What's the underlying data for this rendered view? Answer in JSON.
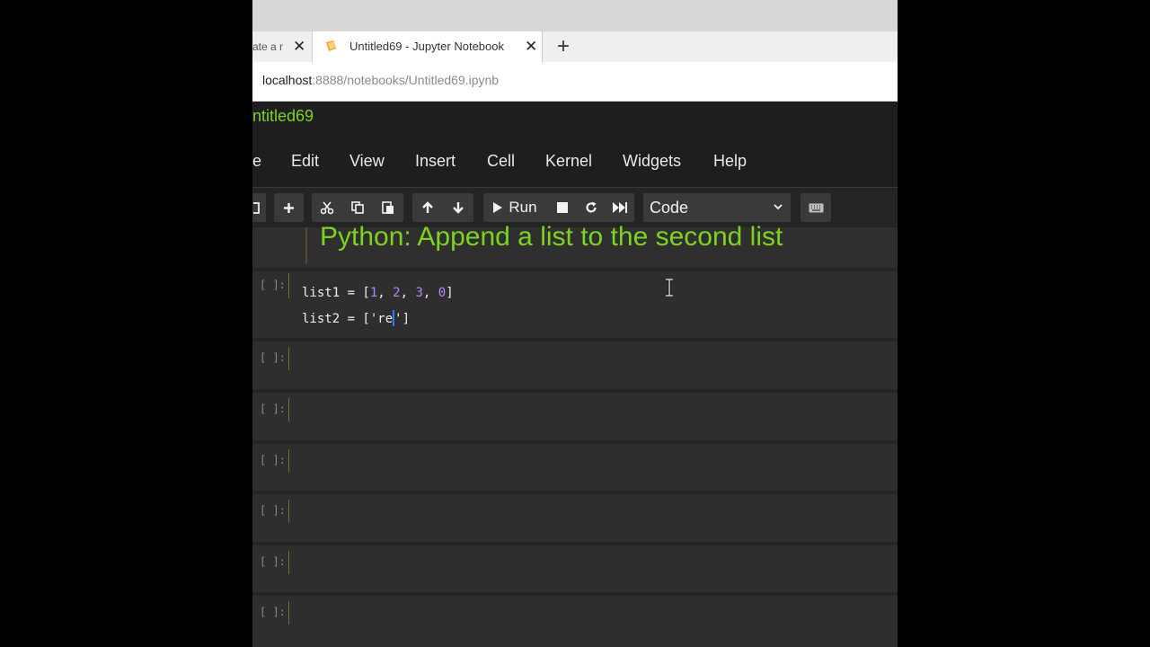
{
  "browser": {
    "prev_tab_title": "ate a r",
    "active_tab_title": "Untitled69 - Jupyter Notebook",
    "close_glyph": "✕",
    "new_tab_glyph": "+",
    "url_host": "localhost",
    "url_path": ":8888/notebooks/Untitled69.ipynb"
  },
  "jupyter": {
    "notebook_title": "ntitled69",
    "menu": [
      "e",
      "Edit",
      "View",
      "Insert",
      "Cell",
      "Kernel",
      "Widgets",
      "Help"
    ],
    "toolbar": {
      "run_label": "Run",
      "cell_type": "Code"
    },
    "markdown_heading": "Python: Append a list to the second list",
    "cell_prompt": "[ ]:",
    "code": {
      "line1_prefix": "list1 = [",
      "line1_n1": "1",
      "line1_n2": "2",
      "line1_n3": "3",
      "line1_n4": "0",
      "sep": ", ",
      "line1_suffix": "]",
      "line2_prefix": "list2 = [",
      "line2_str_before_caret": "'re",
      "line2_str_after_caret": "'",
      "line2_suffix": "]"
    }
  },
  "colors": {
    "accent_green": "#7ed321",
    "number_purple": "#b088ff",
    "caret_blue": "#2d7cff"
  },
  "icons": [
    "jupyter-favicon",
    "close-icon",
    "plus-icon",
    "save-icon",
    "add-cell-icon",
    "cut-icon",
    "copy-icon",
    "paste-icon",
    "move-up-icon",
    "move-down-icon",
    "run-icon",
    "stop-icon",
    "restart-icon",
    "fast-forward-icon",
    "chevron-down-icon",
    "keyboard-icon",
    "text-cursor-icon"
  ]
}
